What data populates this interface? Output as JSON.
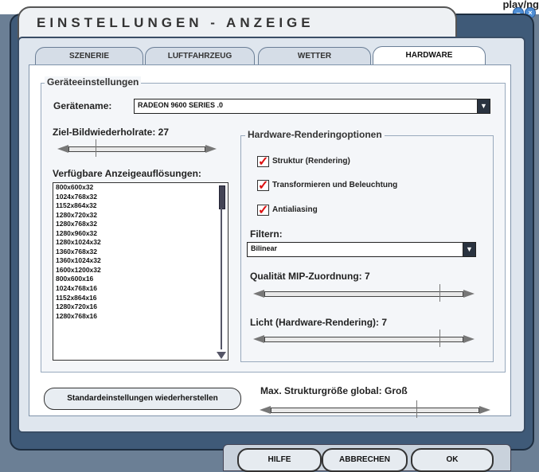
{
  "topbar": {
    "partial_text": "play/ng"
  },
  "window": {
    "title": "EINSTELLUNGEN - ANZEIGE"
  },
  "tabs": [
    {
      "label": "SZENERIE"
    },
    {
      "label": "LUFTFAHRZEUG"
    },
    {
      "label": "WETTER"
    },
    {
      "label": "HARDWARE"
    }
  ],
  "device_group": {
    "title": "Geräteeinstellungen",
    "device_label": "Gerätename:",
    "device_value": "RADEON 9600 SERIES .0",
    "refresh_label": "Ziel-Bildwiederholrate: 27",
    "resolutions_label": "Verfügbare Anzeigeauflösungen:",
    "resolutions": [
      "800x600x32",
      "1024x768x32",
      "1152x864x32",
      "1280x720x32",
      "1280x768x32",
      "1280x960x32",
      "1280x1024x32",
      "1360x768x32",
      "1360x1024x32",
      "1600x1200x32",
      "800x600x16",
      "1024x768x16",
      "1152x864x16",
      "1280x720x16",
      "1280x768x16"
    ],
    "selected_resolution": "1024x768x32"
  },
  "hardware_group": {
    "title": "Hardware-Renderingoptionen",
    "checkboxes": [
      {
        "label": "Struktur (Rendering)",
        "checked": true
      },
      {
        "label": "Transformieren und Beleuchtung",
        "checked": true
      },
      {
        "label": "Antialiasing",
        "checked": true
      }
    ],
    "filter_label": "Filtern:",
    "filter_value": "Bilinear",
    "mip_label": "Qualität MIP-Zuordnung: 7",
    "light_label": "Licht (Hardware-Rendering): 7"
  },
  "reset_button": "Standardeinstellungen wiederherstellen",
  "max_texture_label": "Max. Strukturgröße global: Groß",
  "footer": {
    "help": "HILFE",
    "cancel": "ABBRECHEN",
    "ok": "OK"
  },
  "sliders": {
    "refresh_level": 0.2,
    "mip_level": 0.88,
    "light_level": 0.88,
    "max_texture_level": 0.7
  }
}
